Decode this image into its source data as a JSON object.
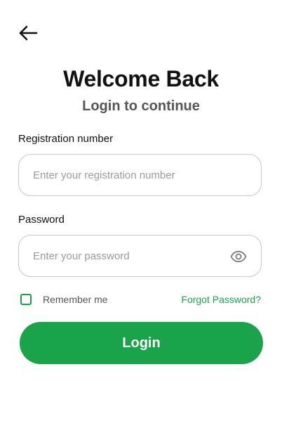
{
  "header": {
    "back_icon": "arrow-left-icon",
    "title": "Welcome Back",
    "subtitle": "Login to continue"
  },
  "form": {
    "registration": {
      "label": "Registration number",
      "value": "",
      "placeholder": "Enter your registration number"
    },
    "password": {
      "label": "Password",
      "value": "",
      "placeholder": "Enter your password",
      "toggle_icon": "eye-icon"
    },
    "remember": {
      "label": "Remember me",
      "checked": false
    },
    "forgot_label": "Forgot Password?",
    "login_label": "Login"
  },
  "colors": {
    "accent": "#1aa34a",
    "input_border": "#c8c8c8",
    "title": "#111111",
    "subtitle": "#555555",
    "placeholder": "#9a9a9a"
  }
}
